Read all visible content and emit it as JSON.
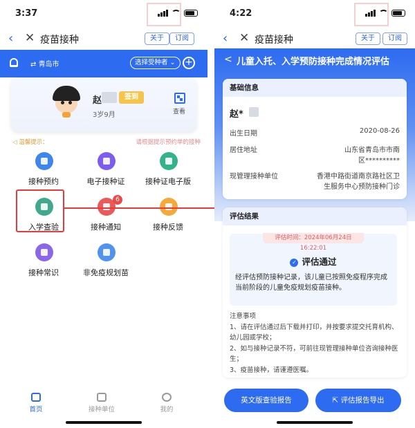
{
  "colors": {
    "primary": "#2d6bf0",
    "highlight": "#e83a3a",
    "accent_yellow": "#f6c44a"
  },
  "left": {
    "status_time": "3:37",
    "nav": {
      "title": "疫苗接种",
      "about": "关于",
      "subscribe": "订阅"
    },
    "header": {
      "city": "青岛市",
      "select_vaccinee": "选择受种者"
    },
    "profile": {
      "name_visible": "赵",
      "signin": "签到",
      "age": "3岁9月",
      "view": "查看"
    },
    "tip": {
      "left": "温馨提示：",
      "right": "请根据提示预约单的接种"
    },
    "services": [
      {
        "label": "接种预约",
        "icon": "calendar-icon",
        "color": "#3d86f0"
      },
      {
        "label": "电子接种证",
        "icon": "e-certificate-icon",
        "color": "#7d5cf0"
      },
      {
        "label": "接种证电子版",
        "icon": "certificate-book-icon",
        "color": "#33b38a"
      },
      {
        "label": "入学查验",
        "icon": "school-check-icon",
        "color": "#41a88d"
      },
      {
        "label": "接种通知",
        "icon": "notification-icon",
        "color": "#ea5a5a",
        "badge": "6"
      },
      {
        "label": "接种反馈",
        "icon": "feedback-icon",
        "color": "#f4a93a"
      },
      {
        "label": "接种常识",
        "icon": "knowledge-icon",
        "color": "#8a66e8"
      },
      {
        "label": "非免疫规划苗",
        "icon": "vaccine-plan-icon",
        "color": "#4f92f0"
      }
    ],
    "tabs": [
      {
        "label": "首页",
        "icon": "home-icon"
      },
      {
        "label": "接种单位",
        "icon": "building-icon"
      },
      {
        "label": "我的",
        "icon": "profile-icon"
      }
    ]
  },
  "right": {
    "status_time": "4:22",
    "nav": {
      "title": "疫苗接种",
      "about": "关于",
      "subscribe": "订阅"
    },
    "header_title": "儿童入托、入学预防接种完成情况评估",
    "basic": {
      "title": "基础信息",
      "name_visible": "赵*",
      "dob_label": "出生日期",
      "dob_value": "2020-08-26",
      "addr_label": "居住地址",
      "addr_value_1": "山东省青岛市市南",
      "addr_value_2": "区**********",
      "unit_label": "现管理接种单位",
      "unit_value_1": "香港中路街道南京路社区卫",
      "unit_value_2": "生服务中心预防接种门诊"
    },
    "result": {
      "title": "评估结果",
      "time": "评估时间：2024年06月24日 16:22:01",
      "status": "评估通过",
      "desc": "经评估预防接种记录，该儿童已按照免疫程序完成当前阶段的儿童免疫规划疫苗接种。",
      "notes_title": "注意事项",
      "notes": [
        "1、请在评估通过后下载并打印，并按要求提交托育机构、幼儿园或学校；",
        "2、如与接种记录不符，可前往现管理接种单位咨询接种医生；",
        "3、疫苗接种，请谨遵医嘱。"
      ]
    },
    "buttons": {
      "english_report": "英文版查验报告",
      "export_report": "评估报告导出"
    }
  }
}
